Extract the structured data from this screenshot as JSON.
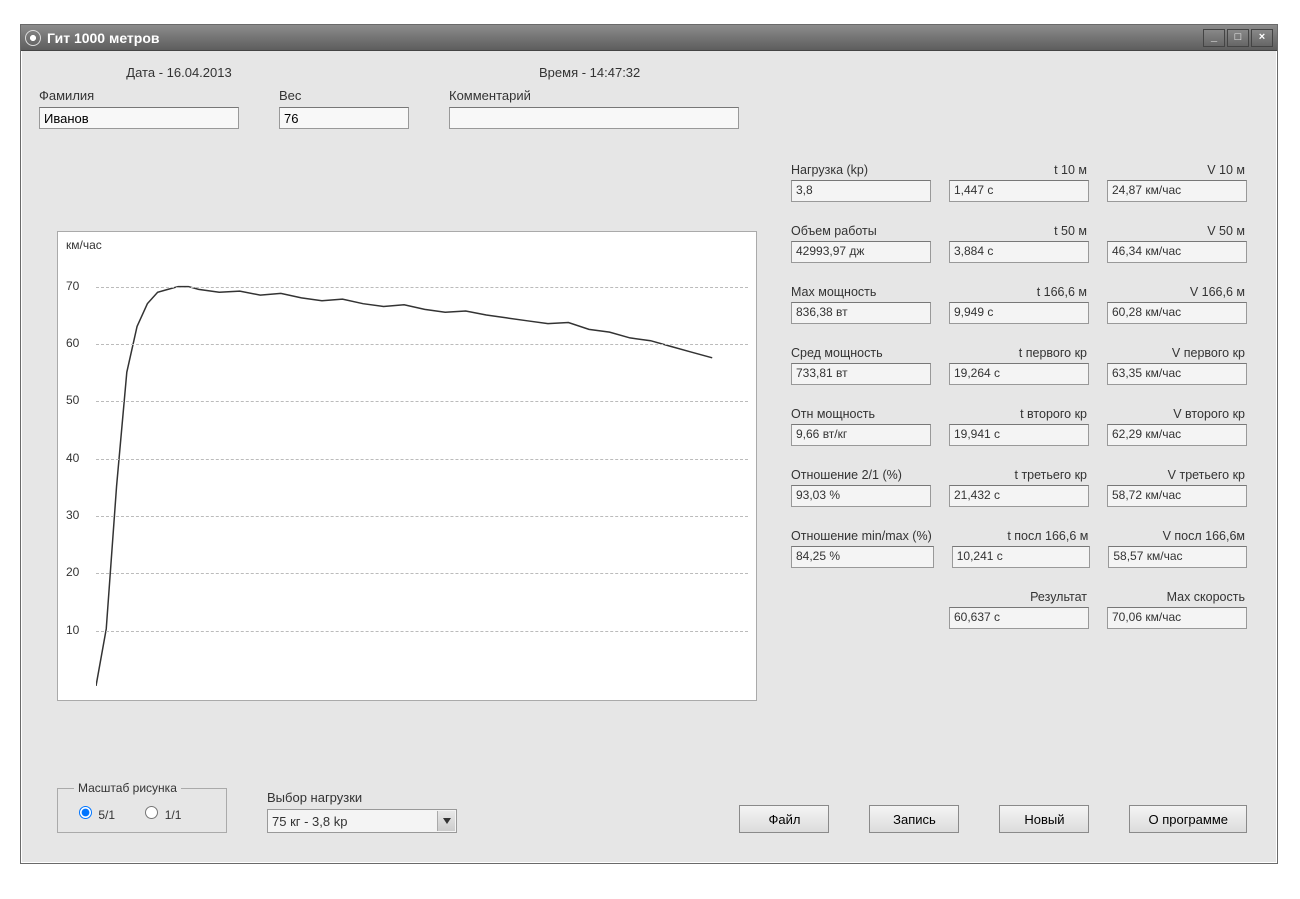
{
  "window_title": "Гит 1000 метров",
  "header": {
    "date_label": "Дата - 16.04.2013",
    "time_label": "Время - 14:47:32"
  },
  "inputs": {
    "surname_label": "Фамилия",
    "surname_value": "Иванов",
    "weight_label": "Вес",
    "weight_value": "76",
    "comment_label": "Комментарий",
    "comment_value": ""
  },
  "metrics": {
    "col1": [
      {
        "label": "Нагрузка (kp)",
        "value": "3,8"
      },
      {
        "label": "Объем работы",
        "value": "42993,97 дж"
      },
      {
        "label": "Мах мощность",
        "value": "836,38 вт"
      },
      {
        "label": "Сред мощность",
        "value": "733,81 вт"
      },
      {
        "label": "Отн мощность",
        "value": "9,66 вт/кг"
      },
      {
        "label": "Отношение 2/1 (%)",
        "value": "93,03 %"
      },
      {
        "label": "Отношение min/max (%)",
        "value": "84,25 %"
      }
    ],
    "col2": [
      {
        "label": "t 10 м",
        "value": "1,447 с"
      },
      {
        "label": "t 50 м",
        "value": "3,884 с"
      },
      {
        "label": "t 166,6 м",
        "value": "9,949 с"
      },
      {
        "label": "t первого кр",
        "value": "19,264 с"
      },
      {
        "label": "t второго кр",
        "value": "19,941 с"
      },
      {
        "label": "t третьего кр",
        "value": "21,432 с"
      },
      {
        "label": "t посл 166,6 м",
        "value": "10,241 с"
      },
      {
        "label": "Результат",
        "value": "60,637 с"
      }
    ],
    "col3": [
      {
        "label": "V 10 м",
        "value": "24,87 км/час"
      },
      {
        "label": "V 50 м",
        "value": "46,34 км/час"
      },
      {
        "label": "V 166,6 м",
        "value": "60,28 км/час"
      },
      {
        "label": "V первого кр",
        "value": "63,35 км/час"
      },
      {
        "label": "V второго кр",
        "value": "62,29 км/час"
      },
      {
        "label": "V третьего кр",
        "value": "58,72 км/час"
      },
      {
        "label": "V посл 166,6м",
        "value": "58,57 км/час"
      },
      {
        "label": "Мах скорость",
        "value": "70,06 км/час"
      }
    ]
  },
  "scale_group": {
    "legend": "Масштаб рисунка",
    "opt1": "5/1",
    "opt2": "1/1"
  },
  "load_select": {
    "label": "Выбор нагрузки",
    "value": "75 кг - 3,8 kp"
  },
  "buttons": {
    "file": "Файл",
    "record": "Запись",
    "new": "Новый",
    "about": "О программе"
  },
  "chart_data": {
    "type": "line",
    "ylabel": "км/час",
    "y_ticks": [
      10,
      20,
      30,
      40,
      50,
      60,
      70
    ],
    "ylim": [
      0,
      75
    ],
    "x": [
      0,
      1,
      2,
      3,
      4,
      5,
      6,
      7,
      8,
      9,
      10,
      12,
      14,
      16,
      18,
      20,
      22,
      24,
      26,
      28,
      30,
      32,
      34,
      36,
      38,
      40,
      42,
      44,
      46,
      48,
      50,
      52,
      54,
      56,
      58,
      60
    ],
    "values": [
      0,
      10,
      35,
      55,
      63,
      67,
      69,
      69.5,
      70,
      70,
      69.5,
      69,
      69.2,
      68.5,
      68.8,
      68,
      67.5,
      67.8,
      67,
      66.5,
      66.8,
      66,
      65.5,
      65.7,
      65,
      64.5,
      64,
      63.5,
      63.7,
      62.5,
      62,
      61,
      60.5,
      59.5,
      58.5,
      57.5
    ],
    "title": ""
  },
  "win_buttons": {
    "min": "_",
    "max": "□",
    "close": "×"
  }
}
